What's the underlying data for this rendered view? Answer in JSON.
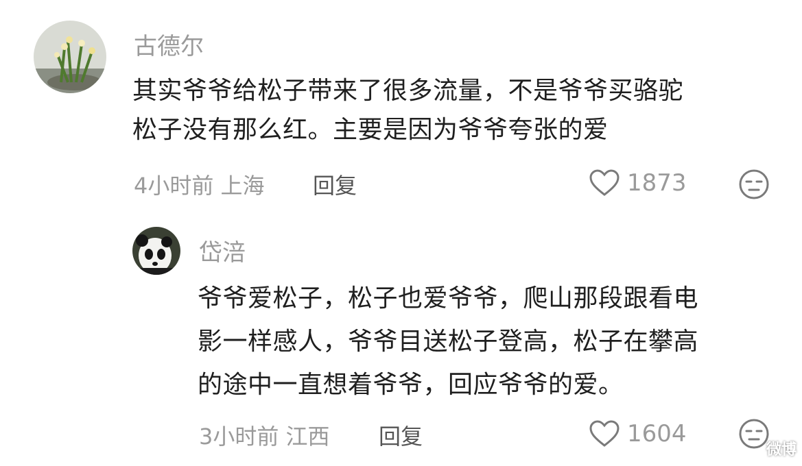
{
  "comments": [
    {
      "username": "古德尔",
      "text": "其实爷爷给松子带来了很多流量，不是爷爷买骆驼\n松子没有那么红。主要是因为爷爷夸张的爱",
      "time_location": "4小时前 上海",
      "reply_label": "回复",
      "likes": "1873"
    },
    {
      "username": "岱涪",
      "text": "爷爷爱松子，松子也爱爷爷，爬山那段跟看电\n影一样感人，爷爷目送松子登高，松子在攀高\n的途中一直想着爷爷，回应爷爷的爱。",
      "time_location": "3小时前 江西",
      "reply_label": "回复",
      "likes": "1604"
    }
  ],
  "watermark": "微博"
}
